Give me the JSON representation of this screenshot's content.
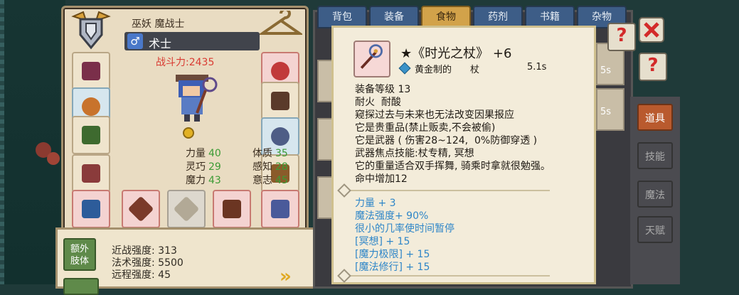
{
  "character": {
    "title": "巫妖 魔战士",
    "class_name": "术士",
    "gender_symbol": "♂",
    "power": "战斗力:2435",
    "stats": [
      {
        "label": "力量",
        "value": "40"
      },
      {
        "label": "体质",
        "value": "35"
      },
      {
        "label": "灵巧",
        "value": "29"
      },
      {
        "label": "感知",
        "value": "28"
      },
      {
        "label": "魔力",
        "value": "43"
      },
      {
        "label": "意志",
        "value": "45"
      }
    ]
  },
  "bottom": {
    "limb_button": "额外\n肢体",
    "lines": [
      "近战强度: 313",
      "法术强度: 5500",
      "远程强度: 45"
    ]
  },
  "tabs": [
    "背包",
    "装备",
    "食物",
    "药剂",
    "书籍",
    "杂物"
  ],
  "active_tab": "食物",
  "tooltip": {
    "name": "★《时光之杖》 +6",
    "quality": "黄金制的",
    "type": "杖",
    "speed": "5.1s",
    "desc": "装备等级 13\n耐火  耐酸\n窥探过去与未来也无法改变因果报应\n它是贵重品(禁止贩卖,不会被偷)\n它是武器 ( 伤害28~124,  0%防御穿透 )\n武器焦点技能:杖专精, 冥想\n它的重量适合双手挥舞, 骑乘时拿就很勉强。\n命中增加12",
    "bonuses": "力量 + 3\n魔法强度+ 90%\n很小的几率使时间暂停\n[冥想] + 15\n[魔力极限] + 15\n[魔法修行] + 15"
  },
  "side_values": [
    "5s",
    "5s"
  ],
  "right_tabs": [
    "道具",
    "技能",
    "魔法",
    "天赋"
  ],
  "help_symbol": "?",
  "colors": {
    "accent": "#d2a24a",
    "power": "#d93b32",
    "stat_value": "#3c9b35",
    "bonus_text": "#2f86c8"
  }
}
